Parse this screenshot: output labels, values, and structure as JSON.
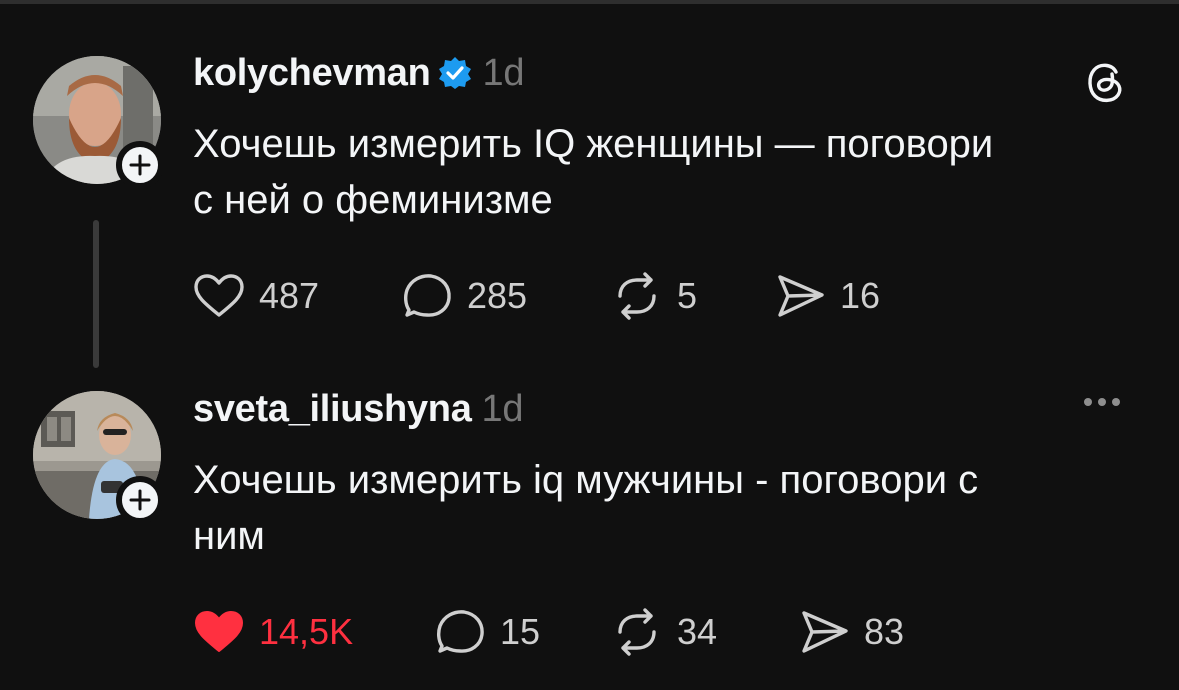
{
  "colors": {
    "background": "#101010",
    "text": "#f3f5f7",
    "muted": "#777777",
    "verified": "#1d9bf0",
    "like_active": "#ff3040"
  },
  "posts": [
    {
      "username": "kolychevman",
      "verified": true,
      "time": "1d",
      "text_lines": [
        "Хочешь измерить IQ женщины — поговори",
        "с ней о феминизме"
      ],
      "likes": "487",
      "replies": "285",
      "reposts": "5",
      "shares": "16",
      "liked": false,
      "header_icon": "threads-logo-icon"
    },
    {
      "username": "sveta_iliushyna",
      "verified": false,
      "time": "1d",
      "text_lines": [
        "Хочешь измерить iq мужчины - поговори с",
        "ним"
      ],
      "likes": "14,5K",
      "replies": "15",
      "reposts": "34",
      "shares": "83",
      "liked": true,
      "header_icon": "more-options-icon"
    }
  ]
}
